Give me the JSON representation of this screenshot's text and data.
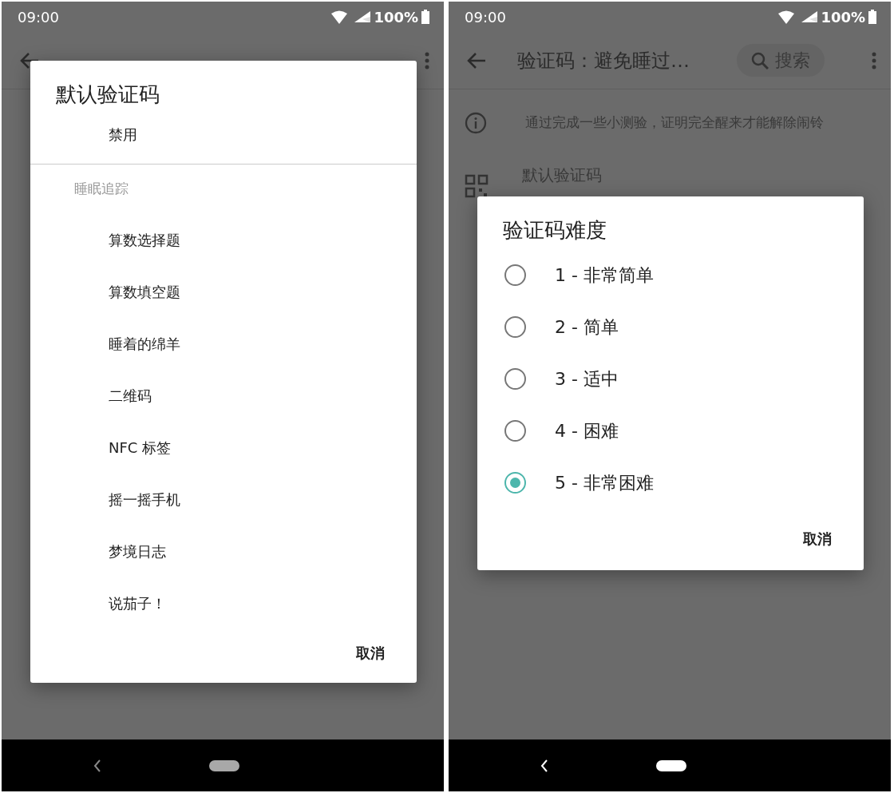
{
  "screens": [
    {
      "status_bar": {
        "time": "09:00",
        "battery": "100%"
      },
      "dialog": {
        "kind": "list",
        "title": "默认验证码",
        "groups": [
          {
            "items": [
              "禁用"
            ]
          },
          {
            "header": "睡眠追踪",
            "items": [
              "算数选择题",
              "算数填空题",
              "睡着的绵羊",
              "二维码",
              "NFC 标签",
              "摇一摇手机",
              "梦境日志",
              "说茄子！"
            ]
          }
        ],
        "button": "取消"
      }
    },
    {
      "status_bar": {
        "time": "09:00",
        "battery": "100%"
      },
      "app_bar": {
        "title": "验证码：避免睡过…",
        "search": "搜索"
      },
      "background": {
        "description": "通过完成一些小测验，证明完全醒来才能解除闹铃",
        "setting": "默认验证码"
      },
      "dialog": {
        "kind": "radio",
        "title": "验证码难度",
        "options": [
          {
            "label": "1 - 非常简单",
            "selected": false
          },
          {
            "label": "2 - 简单",
            "selected": false
          },
          {
            "label": "3 - 适中",
            "selected": false
          },
          {
            "label": "4 - 困难",
            "selected": false
          },
          {
            "label": "5 - 非常困难",
            "selected": true
          }
        ],
        "button": "取消"
      }
    }
  ]
}
